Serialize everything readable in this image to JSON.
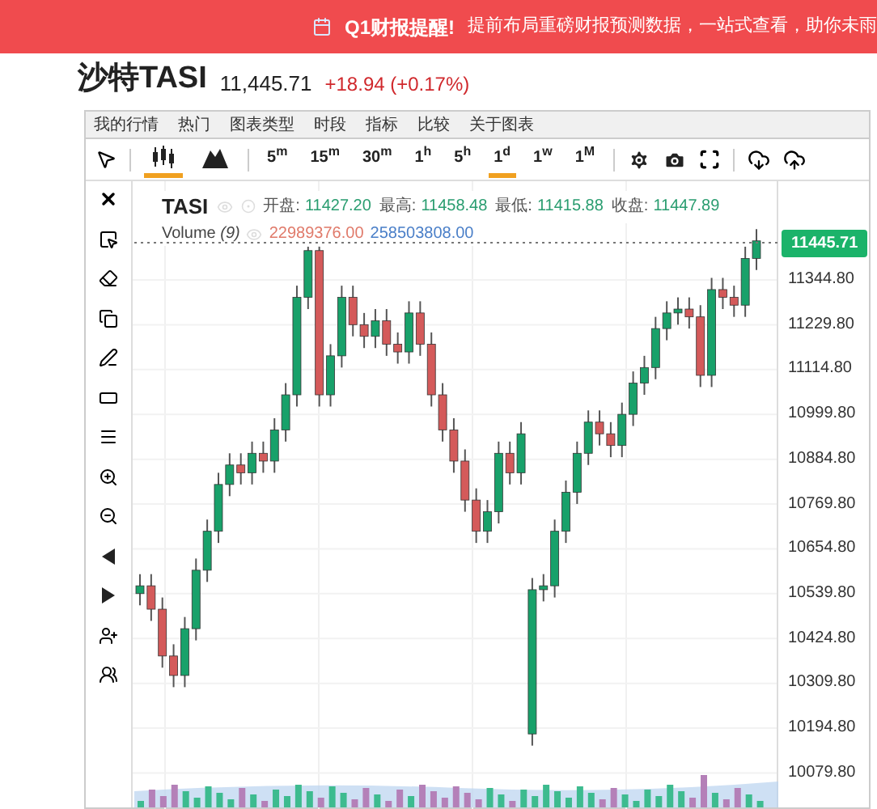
{
  "banner": {
    "title": "Q1财报提醒!",
    "message": "提前布局重磅财报预测数据，一站式查看，助你未雨"
  },
  "quote": {
    "name": "沙特TASI",
    "price": "11,445.71",
    "change": "+18.94 (+0.17%)"
  },
  "menu": [
    "我的行情",
    "热门",
    "图表类型",
    "时段",
    "指标",
    "比较",
    "关于图表"
  ],
  "chart_types": [
    {
      "kind": "candles",
      "selected": true
    },
    {
      "kind": "area",
      "selected": false
    }
  ],
  "timeframes": [
    {
      "value": "5",
      "unit": "m",
      "selected": false
    },
    {
      "value": "15",
      "unit": "m",
      "selected": false
    },
    {
      "value": "30",
      "unit": "m",
      "selected": false
    },
    {
      "value": "1",
      "unit": "h",
      "selected": false
    },
    {
      "value": "5",
      "unit": "h",
      "selected": false
    },
    {
      "value": "1",
      "unit": "d",
      "selected": true
    },
    {
      "value": "1",
      "unit": "w",
      "selected": false
    },
    {
      "value": "1",
      "unit": "M",
      "selected": false
    }
  ],
  "legend": {
    "symbol": "TASI",
    "fields": [
      {
        "label": "开盘:",
        "value": "11427.20"
      },
      {
        "label": "最高:",
        "value": "11458.48"
      },
      {
        "label": "最低:",
        "value": "11415.88"
      },
      {
        "label": "收盘:",
        "value": "11447.89"
      }
    ],
    "volume_label": "Volume *(9)*",
    "volume_values": [
      "22989376.00",
      "258503808.00"
    ]
  },
  "price_tag": "11445.71",
  "chart": {
    "chart_data": {
      "type": "candlestick",
      "grid": true,
      "ylim": [
        9987.4,
        11598.0
      ],
      "ohlc": [
        [
          10540,
          10590,
          10510,
          10560
        ],
        [
          10560,
          10590,
          10470,
          10500
        ],
        [
          10500,
          10530,
          10350,
          10380
        ],
        [
          10380,
          10410,
          10300,
          10330
        ],
        [
          10330,
          10480,
          10300,
          10450
        ],
        [
          10450,
          10630,
          10420,
          10600
        ],
        [
          10600,
          10730,
          10570,
          10700
        ],
        [
          10700,
          10850,
          10670,
          10820
        ],
        [
          10820,
          10900,
          10790,
          10870
        ],
        [
          10870,
          10900,
          10820,
          10850
        ],
        [
          10850,
          10930,
          10820,
          10900
        ],
        [
          10900,
          10930,
          10850,
          10880
        ],
        [
          10880,
          10990,
          10850,
          10960
        ],
        [
          10960,
          11080,
          10930,
          11050
        ],
        [
          11050,
          11330,
          11020,
          11300
        ],
        [
          11300,
          11430,
          11270,
          11420
        ],
        [
          11420,
          11430,
          11020,
          11050
        ],
        [
          11050,
          11180,
          11020,
          11150
        ],
        [
          11150,
          11330,
          11120,
          11300
        ],
        [
          11300,
          11330,
          11200,
          11230
        ],
        [
          11230,
          11260,
          11170,
          11200
        ],
        [
          11200,
          11270,
          11170,
          11240
        ],
        [
          11240,
          11270,
          11150,
          11180
        ],
        [
          11180,
          11210,
          11130,
          11160
        ],
        [
          11160,
          11290,
          11130,
          11260
        ],
        [
          11260,
          11290,
          11150,
          11180
        ],
        [
          11180,
          11210,
          11020,
          11050
        ],
        [
          11050,
          11080,
          10930,
          10960
        ],
        [
          10960,
          10990,
          10850,
          10880
        ],
        [
          10880,
          10910,
          10750,
          10780
        ],
        [
          10780,
          10810,
          10670,
          10700
        ],
        [
          10700,
          10780,
          10670,
          10750
        ],
        [
          10750,
          10930,
          10720,
          10900
        ],
        [
          10900,
          10930,
          10820,
          10850
        ],
        [
          10850,
          10980,
          10820,
          10950
        ],
        [
          10180,
          10580,
          10150,
          10550
        ],
        [
          10550,
          10590,
          10520,
          10560
        ],
        [
          10560,
          10730,
          10530,
          10700
        ],
        [
          10700,
          10830,
          10670,
          10800
        ],
        [
          10800,
          10930,
          10770,
          10900
        ],
        [
          10900,
          11010,
          10870,
          10980
        ],
        [
          10980,
          11010,
          10920,
          10950
        ],
        [
          10950,
          10980,
          10890,
          10920
        ],
        [
          10920,
          11030,
          10890,
          11000
        ],
        [
          11000,
          11110,
          10970,
          11080
        ],
        [
          11080,
          11150,
          11050,
          11120
        ],
        [
          11120,
          11250,
          11090,
          11220
        ],
        [
          11220,
          11290,
          11190,
          11260
        ],
        [
          11260,
          11300,
          11230,
          11270
        ],
        [
          11270,
          11300,
          11220,
          11250
        ],
        [
          11250,
          11280,
          11070,
          11100
        ],
        [
          11100,
          11350,
          11070,
          11320
        ],
        [
          11320,
          11350,
          11270,
          11300
        ],
        [
          11300,
          11330,
          11250,
          11280
        ],
        [
          11280,
          11430,
          11250,
          11400
        ],
        [
          11400,
          11475,
          11370,
          11445
        ]
      ],
      "yticks": [
        {
          "value": 11344.8,
          "label": "11344.80"
        },
        {
          "value": 11229.8,
          "label": "11229.80"
        },
        {
          "value": 11114.8,
          "label": "11114.80"
        },
        {
          "value": 10999.8,
          "label": "10999.80"
        },
        {
          "value": 10884.8,
          "label": "10884.80"
        },
        {
          "value": 10769.8,
          "label": "10769.80"
        },
        {
          "value": 10654.8,
          "label": "10654.80"
        },
        {
          "value": 10539.8,
          "label": "10539.80"
        },
        {
          "value": 10424.8,
          "label": "10424.80"
        },
        {
          "value": 10309.8,
          "label": "10309.80"
        },
        {
          "value": 10194.8,
          "label": "10194.80"
        },
        {
          "value": 10079.8,
          "label": "10079.80"
        }
      ]
    }
  }
}
